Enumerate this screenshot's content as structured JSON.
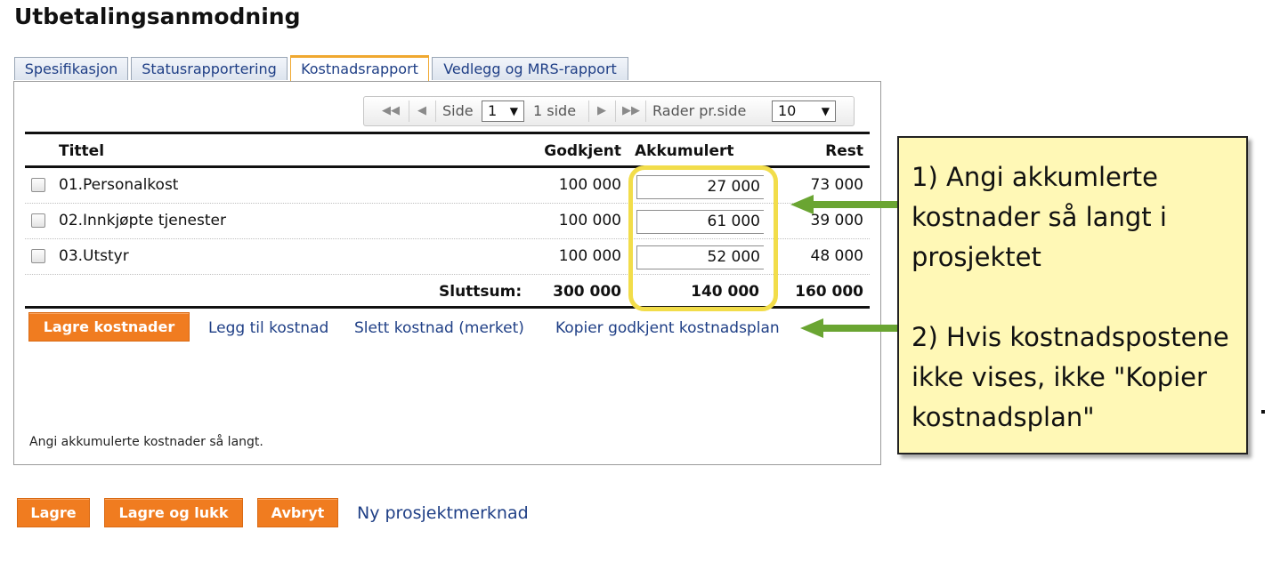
{
  "page_title": "Utbetalingsanmodning",
  "tabs": [
    {
      "label": "Spesifikasjon"
    },
    {
      "label": "Statusrapportering"
    },
    {
      "label": "Kostnadsrapport"
    },
    {
      "label": "Vedlegg og MRS-rapport"
    }
  ],
  "active_tab": "Kostnadsrapport",
  "pager": {
    "side_label": "Side",
    "page_value": "1",
    "page_count_text": "1 side",
    "rows_label": "Rader pr.side",
    "rows_value": "10"
  },
  "table": {
    "headers": {
      "title": "Tittel",
      "approved": "Godkjent",
      "accumulated": "Akkumulert",
      "rest": "Rest"
    },
    "rows": [
      {
        "title": "01.Personalkost",
        "approved": "100 000",
        "accumulated": "27 000",
        "rest": "73 000"
      },
      {
        "title": "02.Innkjøpte tjenester",
        "approved": "100 000",
        "accumulated": "61 000",
        "rest": "39 000"
      },
      {
        "title": "03.Utstyr",
        "approved": "100 000",
        "accumulated": "52 000",
        "rest": "48 000"
      }
    ],
    "total": {
      "label": "Sluttsum:",
      "approved": "300 000",
      "accumulated": "140 000",
      "rest": "160 000"
    }
  },
  "actions": {
    "save_costs": "Lagre kostnader",
    "add_cost": "Legg til kostnad",
    "delete_cost": "Slett kostnad (merket)",
    "copy_plan": "Kopier godkjent kostnadsplan"
  },
  "note": "Angi akkumulerte kostnader så langt.",
  "footer": {
    "save": "Lagre",
    "save_close": "Lagre og lukk",
    "cancel": "Avbryt",
    "new_note": "Ny prosjektmerknad"
  },
  "callout": {
    "line1": "1) Angi akkumlerte",
    "line2": "kostnader så langt i",
    "line3": "prosjektet",
    "line4": "2) Hvis kostnadspostene",
    "line5": "ikke vises, ikke \"Kopier",
    "line6": "kostnadsplan\""
  },
  "colors": {
    "accent_orange": "#f07c20",
    "link_blue": "#1f3f86",
    "callout_bg": "#fff8b6",
    "highlight_yellow": "#f2dd4a",
    "arrow_green": "#6aa532"
  }
}
